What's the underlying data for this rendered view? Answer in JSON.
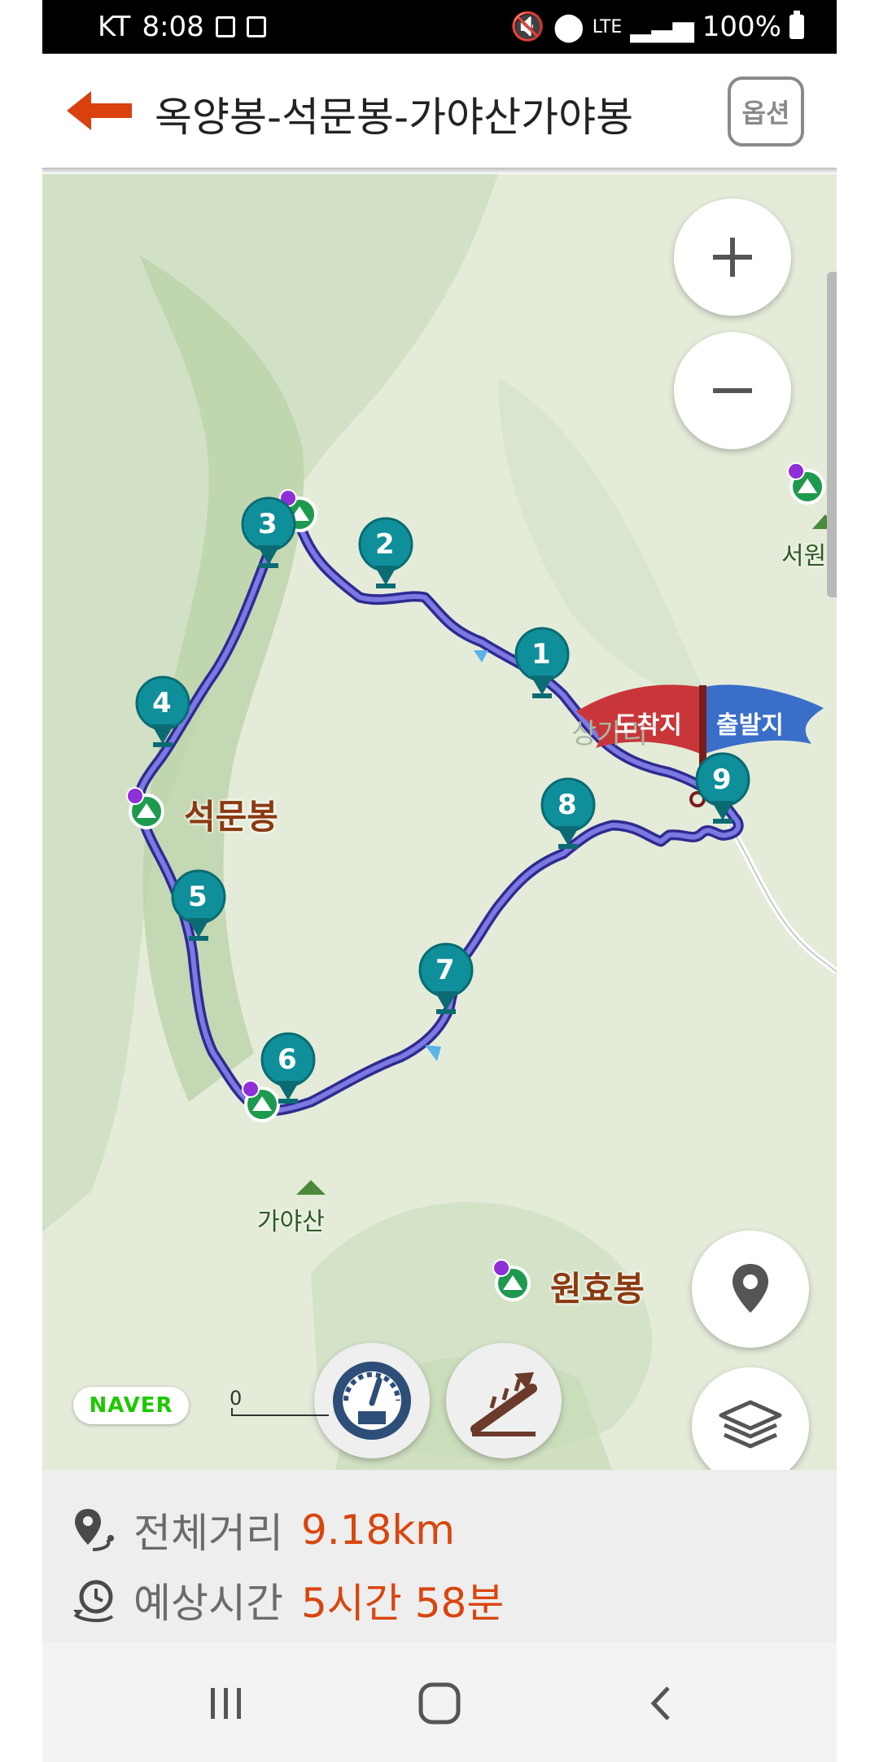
{
  "status_bar": {
    "carrier": "KT",
    "time": "8:08",
    "network": "LTE",
    "battery": "100%"
  },
  "header": {
    "title": "옥양봉-석문봉-가야산가야봉",
    "option_label": "옵션"
  },
  "map": {
    "flags": {
      "arrival": "도착지",
      "departure": "출발지"
    },
    "peaks": [
      {
        "name": "석문봉"
      },
      {
        "name": "원효봉"
      },
      {
        "name": "가야산"
      },
      {
        "name": "서원산"
      }
    ],
    "waypoints": [
      "1",
      "2",
      "3",
      "4",
      "5",
      "6",
      "7",
      "8",
      "9"
    ],
    "faint_label": "상가리",
    "naver_logo": "NAVER",
    "scale_zero": "0"
  },
  "info": {
    "distance_label": "전체거리",
    "distance_value": "9.18km",
    "time_label": "예상시간",
    "time_value": "5시간 58분"
  },
  "colors": {
    "accent": "#d9450f",
    "route": "#5b57c9",
    "marker": "#0f8f9a",
    "map_bg": "#e6eedc"
  }
}
